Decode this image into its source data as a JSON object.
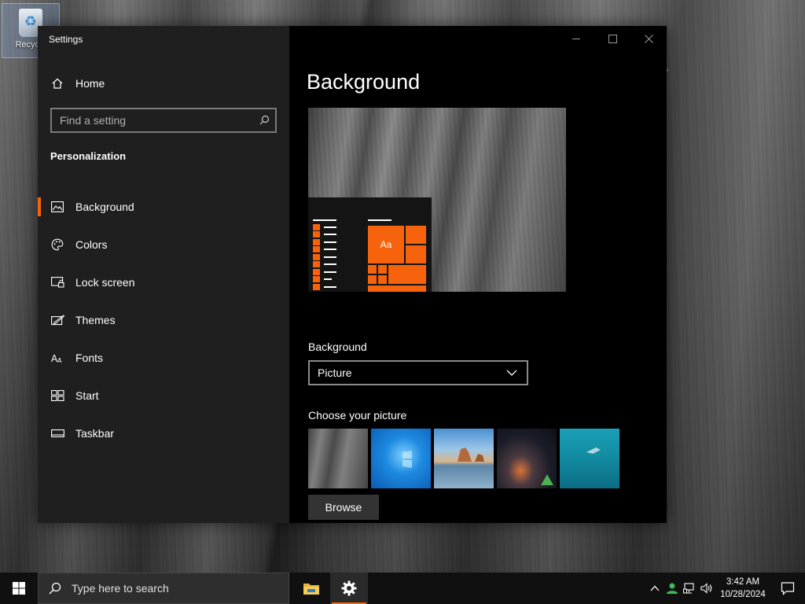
{
  "desktop": {
    "recycle_bin_label": "Recycle"
  },
  "window": {
    "title": "Settings"
  },
  "sidebar": {
    "home_label": "Home",
    "search_placeholder": "Find a setting",
    "section_title": "Personalization",
    "items": [
      {
        "label": "Background",
        "icon": "picture-icon",
        "active": true
      },
      {
        "label": "Colors",
        "icon": "palette-icon",
        "active": false
      },
      {
        "label": "Lock screen",
        "icon": "lock-screen-icon",
        "active": false
      },
      {
        "label": "Themes",
        "icon": "themes-icon",
        "active": false
      },
      {
        "label": "Fonts",
        "icon": "fonts-icon",
        "active": false
      },
      {
        "label": "Start",
        "icon": "start-icon",
        "active": false
      },
      {
        "label": "Taskbar",
        "icon": "taskbar-icon",
        "active": false
      }
    ]
  },
  "main": {
    "title": "Background",
    "preview_tile_label": "Aa",
    "background_label": "Background",
    "background_value": "Picture",
    "choose_label": "Choose your picture",
    "browse_label": "Browse"
  },
  "taskbar": {
    "search_placeholder": "Type here to search",
    "time": "3:42 AM",
    "date": "10/28/2024"
  },
  "colors": {
    "accent": "#f7630c",
    "sidebar_bg": "#1f1f1f",
    "main_bg": "#000000",
    "taskbar_bg": "#101010"
  }
}
